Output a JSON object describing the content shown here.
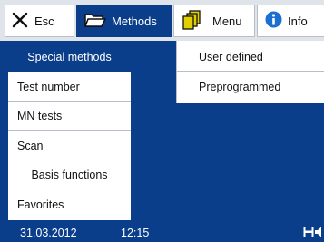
{
  "topbar": {
    "esc_label": "Esc",
    "methods_label": "Methods",
    "menu_label": "Menu",
    "info_label": "Info"
  },
  "left_menu": {
    "items": [
      "Special methods",
      "Test number",
      "MN tests",
      "Scan",
      "Basis functions",
      "Favorites"
    ],
    "selected_index": 0
  },
  "submenu": {
    "items": [
      "User defined",
      "Preprogrammed"
    ]
  },
  "status": {
    "date": "31.03.2012",
    "time": "12:15"
  },
  "icons": {
    "esc": "close-icon",
    "methods": "folder-icon",
    "menu": "pages-icon",
    "info": "info-icon",
    "save": "save-icon",
    "sound": "speaker-icon"
  },
  "colors": {
    "accent": "#0a3d8a",
    "topbar": "#dfe3ea",
    "info": "#1a6fd0",
    "menu_icon": "#e2cf00"
  }
}
